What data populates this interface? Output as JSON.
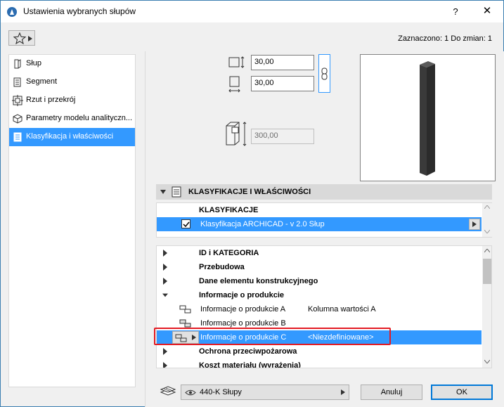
{
  "window": {
    "title": "Ustawienia wybranych słupów",
    "help_label": "?",
    "close_label": "✕",
    "selected_info": "Zaznaczono: 1 Do zmian: 1"
  },
  "sidebar": {
    "items": [
      {
        "label": "Słup",
        "icon": "column-icon"
      },
      {
        "label": "Segment",
        "icon": "segment-icon"
      },
      {
        "label": "Rzut i przekrój",
        "icon": "floor-plan-section-icon"
      },
      {
        "label": "Parametry modelu analityczn...",
        "icon": "analytical-model-icon"
      },
      {
        "label": "Klasyfikacja i właściwości",
        "icon": "classification-icon",
        "active": true
      }
    ]
  },
  "geometry": {
    "width_value": "30,00",
    "depth_value": "30,00",
    "height_value": "300,00"
  },
  "section": {
    "title": "KLASYFIKACJE I WŁAŚCIWOŚCI"
  },
  "classifications": {
    "header": "KLASYFIKACJE",
    "item_label": "Klasyfikacja ARCHICAD - v 2.0 Słup"
  },
  "properties": {
    "groups": [
      {
        "label": "ID i KATEGORIA",
        "expanded": false
      },
      {
        "label": "Przebudowa",
        "expanded": false
      },
      {
        "label": "Dane elementu konstrukcyjnego",
        "expanded": false
      },
      {
        "label": "Informacje o produkcie",
        "expanded": true
      }
    ],
    "items": [
      {
        "name": "Informacje o produkcie A",
        "value": "Kolumna wartości A"
      },
      {
        "name": "Informacje o produkcie B",
        "value": ""
      },
      {
        "name": "Informacje o produkcie C",
        "value": "<Niezdefiniowane>"
      }
    ],
    "groups_after": [
      {
        "label": "Ochrona przeciwpożarowa"
      },
      {
        "label": "Koszt materiału (wyrażenia)"
      }
    ]
  },
  "footer": {
    "layer_label": "440-K Słupy",
    "cancel_label": "Anuluj",
    "ok_label": "OK"
  },
  "colors": {
    "selection": "#3399ff",
    "highlight_box": "#e31b23",
    "column_preview": "#3a3a3a"
  }
}
